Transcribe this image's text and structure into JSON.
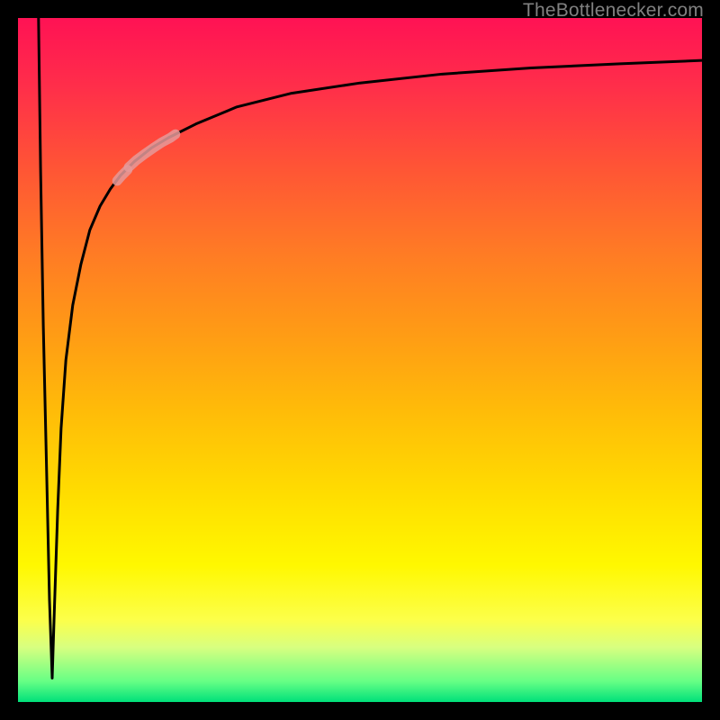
{
  "attribution": "TheBottlenecker.com",
  "chart_data": {
    "type": "line",
    "title": "",
    "xlabel": "",
    "ylabel": "",
    "xlim": [
      0,
      100
    ],
    "ylim": [
      0,
      100
    ],
    "notes": "No axis ticks or labels are visible; values are pixel-estimated on a 0–100 scale. The background encodes a red→green gradient. Two short pink highlight segments overlay the main black curve.",
    "series": [
      {
        "name": "main-curve",
        "color": "#000000",
        "x": [
          3.0,
          3.3,
          3.7,
          4.2,
          4.6,
          5.0,
          5.3,
          5.8,
          6.3,
          7.0,
          8.0,
          9.2,
          10.5,
          12.0,
          13.5,
          15.0,
          17.0,
          19.5,
          22.0,
          26.0,
          32.0,
          40.0,
          50.0,
          62.0,
          75.0,
          88.0,
          100.0
        ],
        "y": [
          100,
          78,
          55,
          33,
          15,
          3.5,
          13,
          28,
          40,
          50,
          58,
          64,
          69,
          72.5,
          75,
          77,
          79,
          81,
          82.5,
          84.5,
          87,
          89,
          90.5,
          91.8,
          92.7,
          93.3,
          93.8
        ]
      },
      {
        "name": "highlight-upper",
        "color": "#e59a9a",
        "x": [
          16.2,
          17.3,
          18.5,
          19.8,
          21.0,
          22.3,
          23.0
        ],
        "y": [
          78.2,
          79.2,
          80.1,
          81.0,
          81.8,
          82.5,
          83.0
        ]
      },
      {
        "name": "highlight-lower",
        "color": "#e59a9a",
        "x": [
          14.5,
          15.2,
          16.0
        ],
        "y": [
          76.2,
          77.0,
          77.8
        ]
      }
    ]
  }
}
